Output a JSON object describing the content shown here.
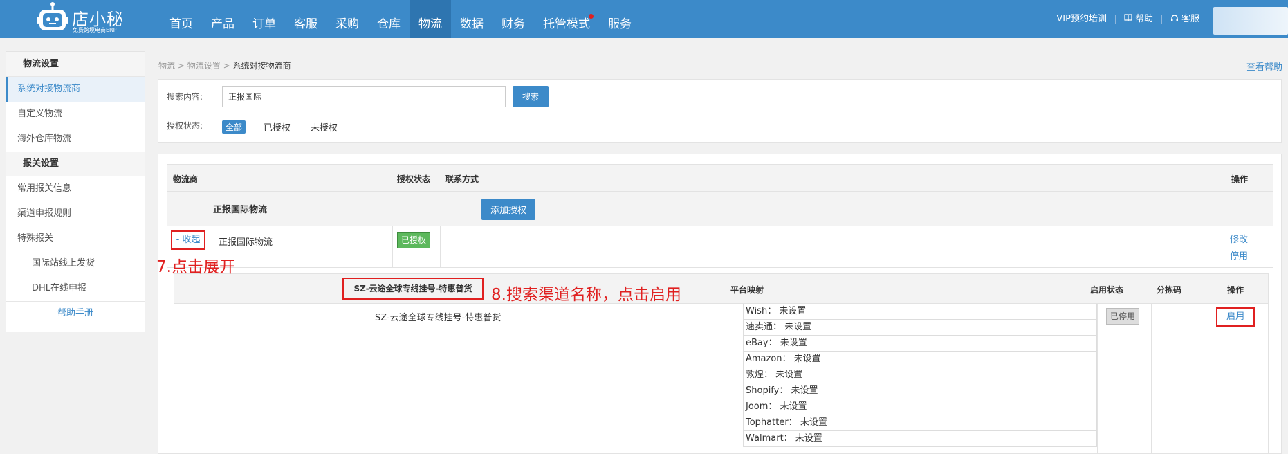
{
  "logo": {
    "name": "店小秘",
    "subtitle": "免费跨境电商ERP"
  },
  "nav": [
    {
      "label": "首页"
    },
    {
      "label": "产品"
    },
    {
      "label": "订单"
    },
    {
      "label": "客服"
    },
    {
      "label": "采购"
    },
    {
      "label": "仓库"
    },
    {
      "label": "物流"
    },
    {
      "label": "数据"
    },
    {
      "label": "财务"
    },
    {
      "label": "托管模式"
    },
    {
      "label": "服务"
    }
  ],
  "topright": {
    "vip": "VIP预约培训",
    "help": "帮助",
    "service": "客服"
  },
  "sidebar": {
    "section1": "物流设置",
    "items1": [
      "系统对接物流商",
      "自定义物流",
      "海外仓库物流"
    ],
    "section2": "报关设置",
    "items2": [
      "常用报关信息",
      "渠道申报规则",
      "特殊报关"
    ],
    "subitems": [
      "国际站线上发货",
      "DHL在线申报"
    ],
    "help": "帮助手册"
  },
  "breadcrumb": {
    "l1": "物流",
    "l2": "物流设置",
    "current": "系统对接物流商",
    "sep": ">"
  },
  "help_link": "查看帮助",
  "search": {
    "label": "搜索内容:",
    "value": "正报国际",
    "button": "搜索",
    "auth_label": "授权状态:",
    "filters": [
      "全部",
      "已授权",
      "未授权"
    ]
  },
  "table": {
    "headers": {
      "carrier": "物流商",
      "auth": "授权状态",
      "contact": "联系方式",
      "action": "操作"
    },
    "group_name": "正报国际物流",
    "add_auth": "添加授权",
    "row": {
      "collapse": "- 收起",
      "name": "正报国际物流",
      "status": "已授权",
      "edit": "修改",
      "disable": "停用"
    }
  },
  "annotations": {
    "step7": "7.点击展开",
    "step8": "8.搜索渠道名称，点击启用"
  },
  "channel": {
    "search_value": "SZ-云途全球专线挂号-特惠普货",
    "headers": {
      "mapping": "平台映射",
      "status": "启用状态",
      "sort_code": "分拣码",
      "action": "操作"
    },
    "name": "SZ-云途全球专线挂号-特惠普货",
    "mappings": [
      "Wish：  未设置",
      "速卖通：  未设置",
      "eBay：  未设置",
      "Amazon：  未设置",
      "敦煌：  未设置",
      "Shopify：  未设置",
      "Joom：  未设置",
      "Tophatter：  未设置",
      "Walmart：  未设置"
    ],
    "status": "已停用",
    "enable": "启用"
  }
}
